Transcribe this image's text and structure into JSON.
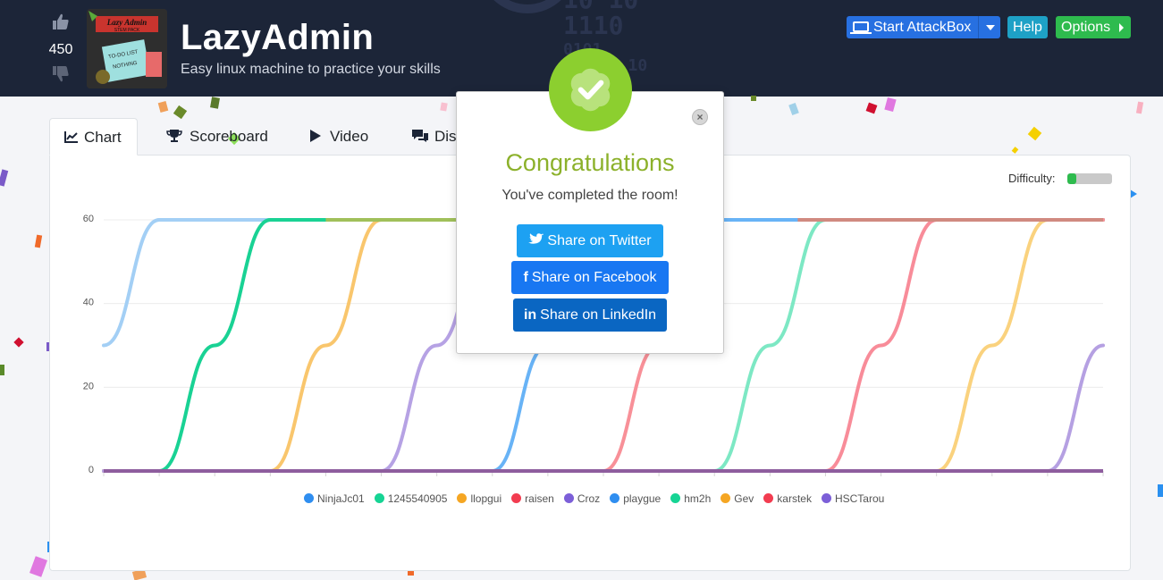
{
  "header": {
    "vote_count": "450",
    "title": "LazyAdmin",
    "subtitle": "Easy linux machine to practice your skills",
    "background_digits": [
      "10 10",
      "1110",
      "0101",
      "01 10"
    ],
    "room_image": {
      "title_line1": "Lazy Admin",
      "title_line2": "STEM PACK",
      "note_line1": "TO-DO LIST",
      "note_line2": "NOTHING"
    },
    "buttons": {
      "attackbox": "Start AttackBox",
      "help": "Help",
      "options": "Options"
    },
    "icons": {
      "upvote": "thumbs-up-icon",
      "downvote": "thumbs-down-icon",
      "attackbox": "laptop-icon"
    }
  },
  "tabs": [
    {
      "label": "Chart",
      "icon": "chart-line-icon",
      "active": true
    },
    {
      "label": "Scoreboard",
      "icon": "trophy-icon",
      "active": false
    },
    {
      "label": "Video",
      "icon": "play-icon",
      "active": false
    },
    {
      "label": "Dis",
      "icon": "comments-icon",
      "active": false
    }
  ],
  "difficulty": {
    "label": "Difficulty:",
    "level": 0.2,
    "color": "#2ebb4e"
  },
  "modal": {
    "title": "Congratulations",
    "message": "You've completed the room!",
    "share_twitter": "Share on Twitter",
    "share_facebook": "Share on Facebook",
    "share_linkedin": "Share on LinkedIn",
    "colors": {
      "title": "#8cb12b",
      "badge": "#8ccf2f",
      "twitter": "#1da1f2",
      "facebook": "#1877f2",
      "linkedin": "#0a66c2"
    }
  },
  "chart_data": {
    "type": "line",
    "yticks": [
      "0",
      "20",
      "40",
      "60"
    ],
    "ylim": [
      0,
      60
    ],
    "xlim": [
      0,
      18
    ],
    "grid": true,
    "legend_position": "bottom",
    "series": [
      {
        "name": "NinjaJc01",
        "color": "#a3cff5",
        "legend_color": "#2f8ef0",
        "points": [
          [
            0,
            30
          ],
          [
            1,
            60
          ],
          [
            18,
            60
          ]
        ]
      },
      {
        "name": "1245540905",
        "color": "#19d294",
        "legend_color": "#16d494",
        "points": [
          [
            0,
            0
          ],
          [
            1,
            0
          ],
          [
            2,
            30
          ],
          [
            3,
            60
          ],
          [
            18,
            60
          ]
        ]
      },
      {
        "name": "llopgui",
        "color": "#f9c66d",
        "legend_color": "#f5a623",
        "points": [
          [
            0,
            0
          ],
          [
            3,
            0
          ],
          [
            4,
            30
          ],
          [
            5,
            60
          ],
          [
            18,
            60
          ]
        ]
      },
      {
        "name": "raisen",
        "color": "#f89098",
        "legend_color": "#f23c50",
        "points": [
          [
            0,
            0
          ],
          [
            9,
            0
          ],
          [
            10,
            30
          ],
          [
            11,
            60
          ],
          [
            18,
            60
          ]
        ]
      },
      {
        "name": "Croz",
        "color": "#b6a2e4",
        "legend_color": "#7c5fd8",
        "points": [
          [
            0,
            0
          ],
          [
            5,
            0
          ],
          [
            6,
            30
          ],
          [
            7,
            60
          ],
          [
            18,
            60
          ]
        ]
      },
      {
        "name": "playgue",
        "color": "#68b3f6",
        "legend_color": "#2f8ef0",
        "points": [
          [
            0,
            0
          ],
          [
            7,
            0
          ],
          [
            8,
            30
          ],
          [
            9,
            60
          ],
          [
            18,
            60
          ]
        ]
      },
      {
        "name": "hm2h",
        "color": "#7de8c4",
        "legend_color": "#16d494",
        "points": [
          [
            0,
            0
          ],
          [
            11,
            0
          ],
          [
            12,
            30
          ],
          [
            13,
            60
          ],
          [
            18,
            60
          ]
        ]
      },
      {
        "name": "Gev",
        "color": "#fad27e",
        "legend_color": "#f5a623",
        "points": [
          [
            0,
            0
          ],
          [
            15,
            0
          ],
          [
            16,
            30
          ],
          [
            17,
            60
          ],
          [
            18,
            60
          ]
        ]
      },
      {
        "name": "karstek",
        "color": "#f88c99",
        "legend_color": "#f23c50",
        "points": [
          [
            0,
            0
          ],
          [
            13,
            0
          ],
          [
            14,
            30
          ],
          [
            15,
            60
          ],
          [
            18,
            60
          ]
        ]
      },
      {
        "name": "HSCTarou",
        "color": "#b5a0e2",
        "legend_color": "#7c5fd8",
        "points": [
          [
            0,
            0
          ],
          [
            17,
            0
          ],
          [
            18,
            30
          ]
        ]
      }
    ],
    "overlay_lines": [
      {
        "color": "#a0c05a",
        "points": [
          [
            4,
            60
          ],
          [
            7,
            60
          ]
        ]
      },
      {
        "color": "#d08a80",
        "points": [
          [
            12.5,
            60
          ],
          [
            18,
            60
          ]
        ]
      },
      {
        "color": "#8e5d9e",
        "points": [
          [
            0,
            0
          ],
          [
            18,
            0
          ]
        ]
      }
    ]
  }
}
